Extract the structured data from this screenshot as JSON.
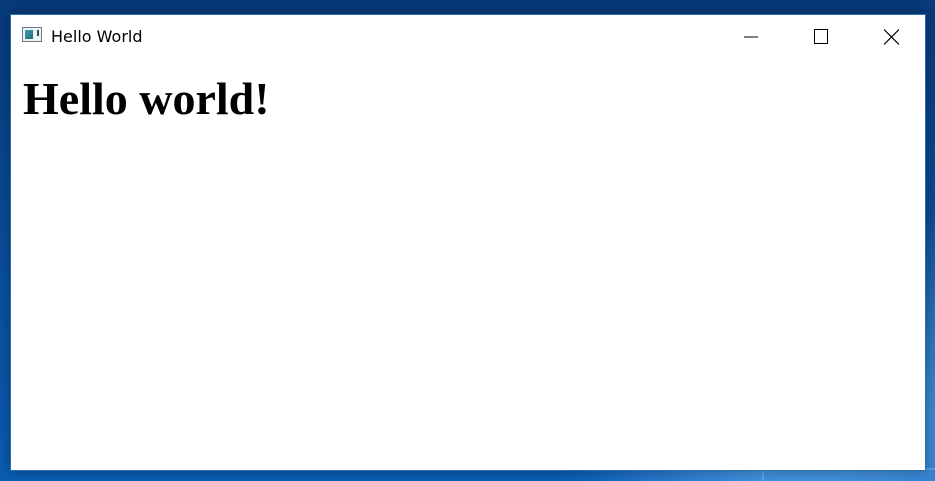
{
  "window": {
    "title": "Hello World"
  },
  "titlebar_icons": {
    "app": "app-window-icon",
    "minimize": "minimize-icon",
    "maximize": "maximize-icon",
    "close": "close-icon"
  },
  "content": {
    "heading": "Hello world!"
  },
  "colors": {
    "desktop_accent": "#0a4f9c",
    "window_background": "#ffffff",
    "text": "#000000"
  }
}
